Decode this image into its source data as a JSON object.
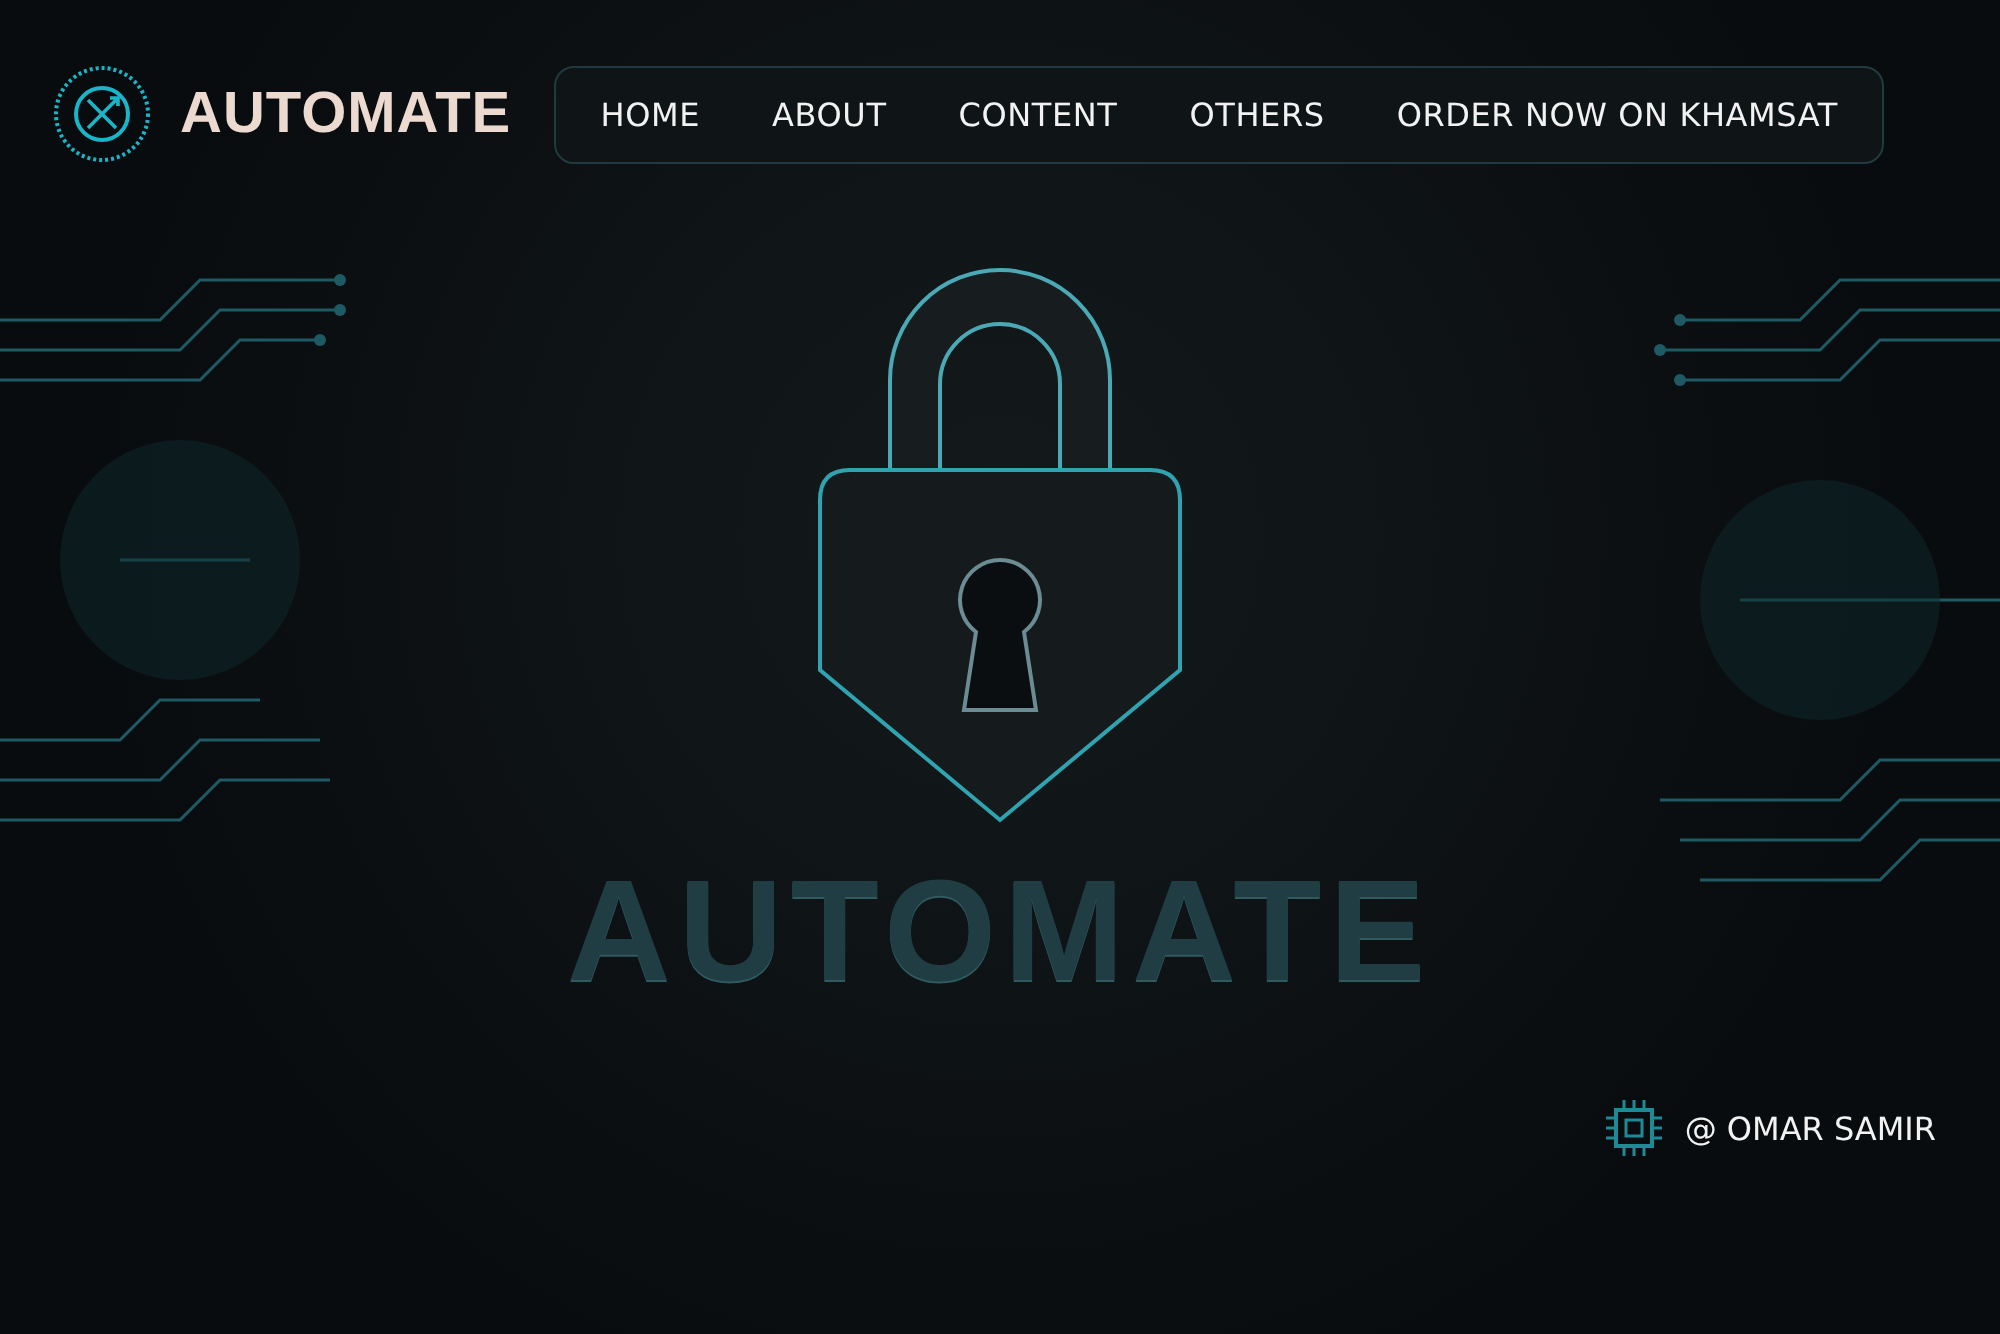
{
  "brand": {
    "name": "AUTOMATE"
  },
  "nav": [
    {
      "label": "HOME"
    },
    {
      "label": "ABOUT"
    },
    {
      "label": "CONTENT"
    },
    {
      "label": "OTHERS"
    },
    {
      "label": "ORDER NOW ON KHAMSAT"
    }
  ],
  "hero": {
    "title": "AUTOMATE"
  },
  "credit": {
    "text": "@ OMAR SAMIR"
  }
}
